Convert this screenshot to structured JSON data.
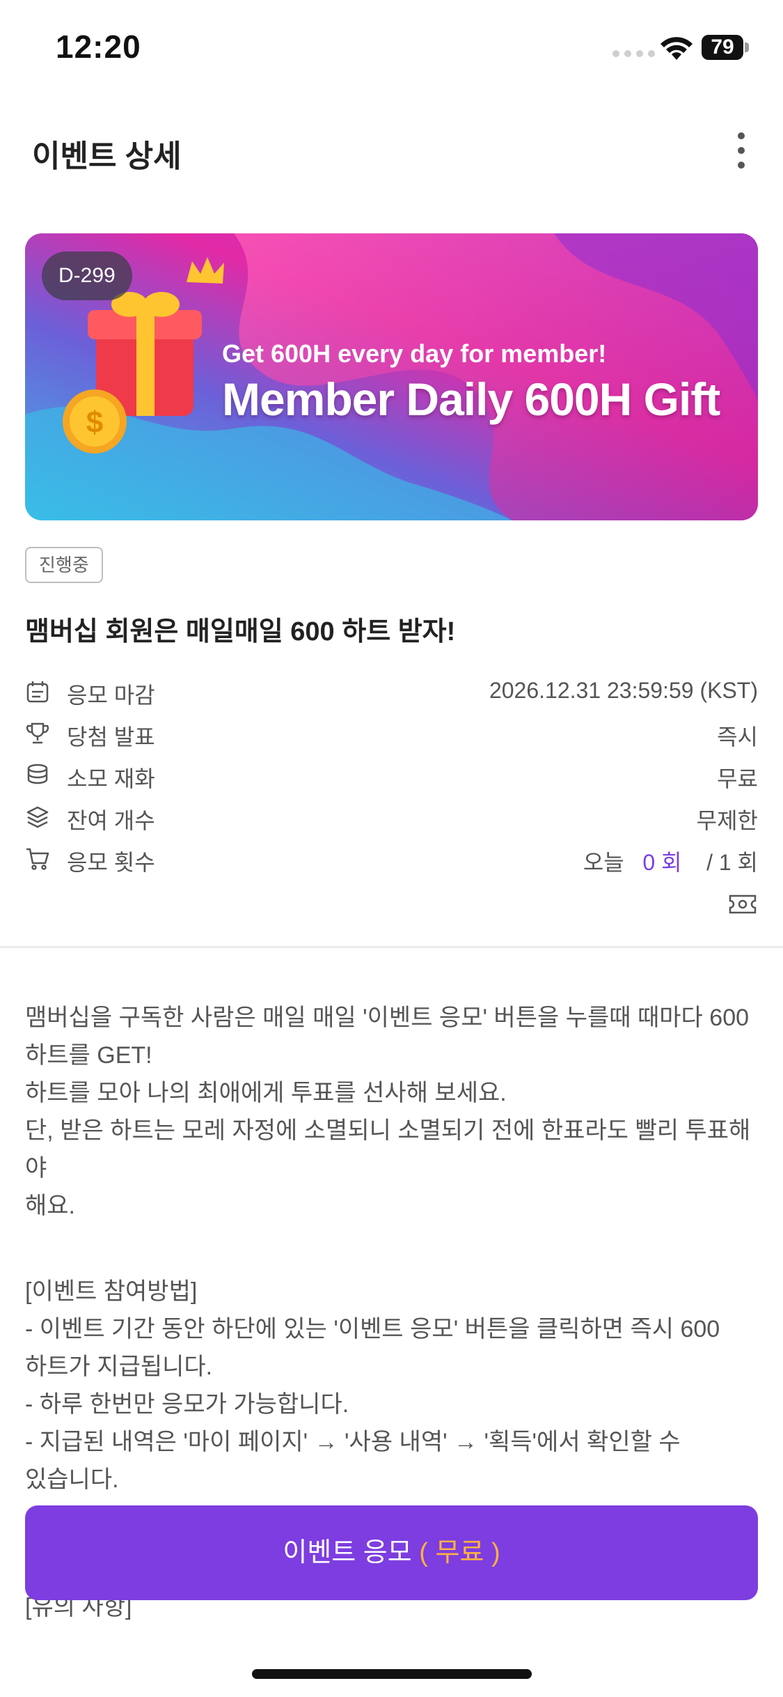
{
  "status_bar": {
    "time": "12:20",
    "battery": "79"
  },
  "header": {
    "title": "이벤트 상세"
  },
  "banner": {
    "d_day": "D-299",
    "subtitle": "Get 600H every day for member!",
    "title": "Member Daily 600H Gift"
  },
  "event": {
    "status": "진행중",
    "title": "맴버십 회원은 매일매일 600 하트 받자!"
  },
  "info": [
    {
      "icon": "calendar-icon",
      "label": "응모 마감",
      "value": "2026.12.31 23:59:59 (KST)"
    },
    {
      "icon": "trophy-icon",
      "label": "당첨 발표",
      "value": "즉시"
    },
    {
      "icon": "coins-icon",
      "label": "소모 재화",
      "value": "무료"
    },
    {
      "icon": "layers-icon",
      "label": "잔여 개수",
      "value": "무제한"
    },
    {
      "icon": "cart-icon",
      "label": "응모 횟수",
      "today_prefix": "오늘",
      "today_count": "0 회",
      "total": "/ 1 회"
    }
  ],
  "description": {
    "line1": "맴버십을 구독한 사람은 매일 매일 '이벤트 응모' 버튼을 누를때 때마다 600",
    "line2": "하트를 GET!",
    "line3": "하트를 모아 나의 최애에게 투표를 선사해 보세요.",
    "line4": "단, 받은 하트는 모레 자정에 소멸되니 소멸되기 전에 한표라도 빨리 투표해야",
    "line5": "해요.",
    "how_title": "[이벤트 참여방법]",
    "how1": "- 이벤트 기간 동안 하단에 있는 '이벤트 응모' 버튼을 클릭하면 즉시 600",
    "how1b": "하트가 지급됩니다.",
    "how2": "- 하루 한번만 응모가 가능합니다.",
    "how3": "- 지급된 내역은 '마이 페이지' → '사용 내역' → '획득'에서 확인할 수",
    "how3b": "있습니다.",
    "notice_title": "[유의 사항]"
  },
  "cta": {
    "label": "이벤트 응모",
    "free": "( 무료 )"
  },
  "colors": {
    "accent": "#7d3de0",
    "free": "#ffb23f",
    "today": "#7b3fe4"
  }
}
